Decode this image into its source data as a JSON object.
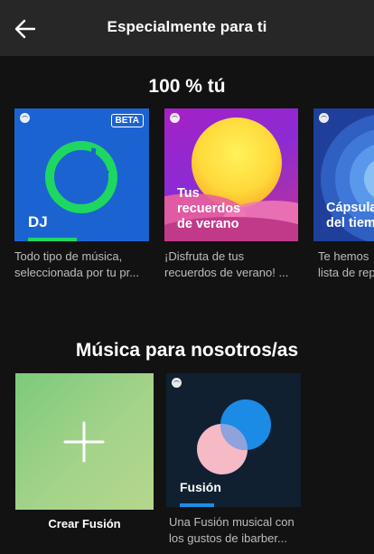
{
  "header": {
    "title": "Especialmente para ti",
    "back_icon": "back-arrow-icon"
  },
  "sections": [
    {
      "title": "100 % tú",
      "cards": [
        {
          "label": "DJ",
          "badge": "BETA",
          "desc_line1": "Todo tipo de música,",
          "desc_line2": "seleccionada por tu pr..."
        },
        {
          "label_line1": "Tus",
          "label_line2": "recuerdos",
          "label_line3": "de verano",
          "desc_line1": "¡Disfruta de tus",
          "desc_line2": "recuerdos de verano! ..."
        },
        {
          "label_line1": "Cápsula",
          "label_line2": "del tiem",
          "desc_line1": "Te hemos",
          "desc_line2": "lista de rep"
        }
      ]
    },
    {
      "title": "Música para nosotros/as",
      "cards": [
        {
          "label": "Crear Fusión",
          "icon": "plus-icon"
        },
        {
          "label": "Fusión",
          "desc_line1": "Una Fusión musical con",
          "desc_line2": "los gustos de ibarber..."
        }
      ]
    }
  ],
  "colors": {
    "background": "#121212",
    "header": "#272727",
    "dj_blue": "#1b63d1",
    "accent_green": "#1ed760",
    "fusion_blue": "#1e8ce8"
  }
}
